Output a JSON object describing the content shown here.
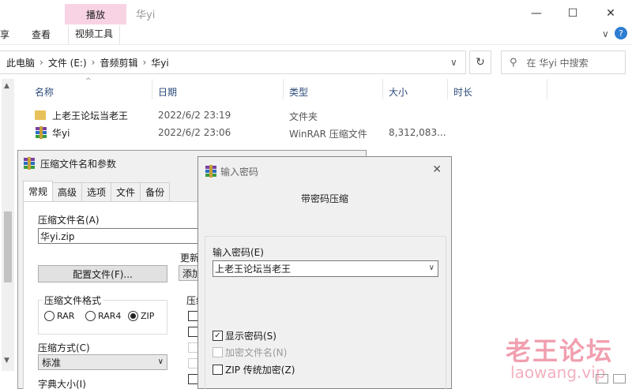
{
  "window": {
    "title": "华yi",
    "context_tab": "播放",
    "minimize": "—",
    "maximize": "☐",
    "close": "✕"
  },
  "ribbon": {
    "tabs": [
      "享",
      "查看",
      "视频工具"
    ],
    "expand": "∨",
    "help": "?"
  },
  "address": {
    "crumbs": [
      "此电脑",
      "文件 (E:)",
      "音频剪辑",
      "华yi"
    ],
    "sep": "›",
    "refresh": "↻",
    "search_placeholder": "在 华yi 中搜索"
  },
  "columns": {
    "name": "名称",
    "date": "日期",
    "type": "类型",
    "size": "大小",
    "duration": "时长"
  },
  "files": [
    {
      "name": "上老王论坛当老王",
      "date": "2022/6/2 23:19",
      "type": "文件夹",
      "size": ""
    },
    {
      "name": "华yi",
      "date": "2022/6/2 23:06",
      "type": "WinRAR 压缩文件",
      "size": "8,312,083..."
    }
  ],
  "archive_dialog": {
    "title": "压缩文件名和参数",
    "tabs": [
      "常规",
      "高级",
      "选项",
      "文件",
      "备份"
    ],
    "archive_name_label": "压缩文件名(A)",
    "archive_name_value": "华yi.zip",
    "update_label": "更新",
    "update_value": "添加",
    "profile_button": "配置文件(F)...",
    "format_group": "压缩文件格式",
    "formats": [
      "RAR",
      "RAR4",
      "ZIP"
    ],
    "selected_format": "ZIP",
    "options_label": "压缩",
    "method_label": "压缩方式(C)",
    "method_value": "标准",
    "dict_label": "字典大小(I)"
  },
  "password_dialog": {
    "title": "输入密码",
    "close": "✕",
    "heading": "带密码压缩",
    "password_label": "输入密码(E)",
    "password_value": "上老王论坛当老王",
    "show_password": "显示密码(S)",
    "encrypt_names": "加密文件名(N)",
    "zip_legacy": "ZIP 传统加密(Z)"
  },
  "watermark": {
    "line1": "老王论坛",
    "line2": "laowang.vip"
  }
}
